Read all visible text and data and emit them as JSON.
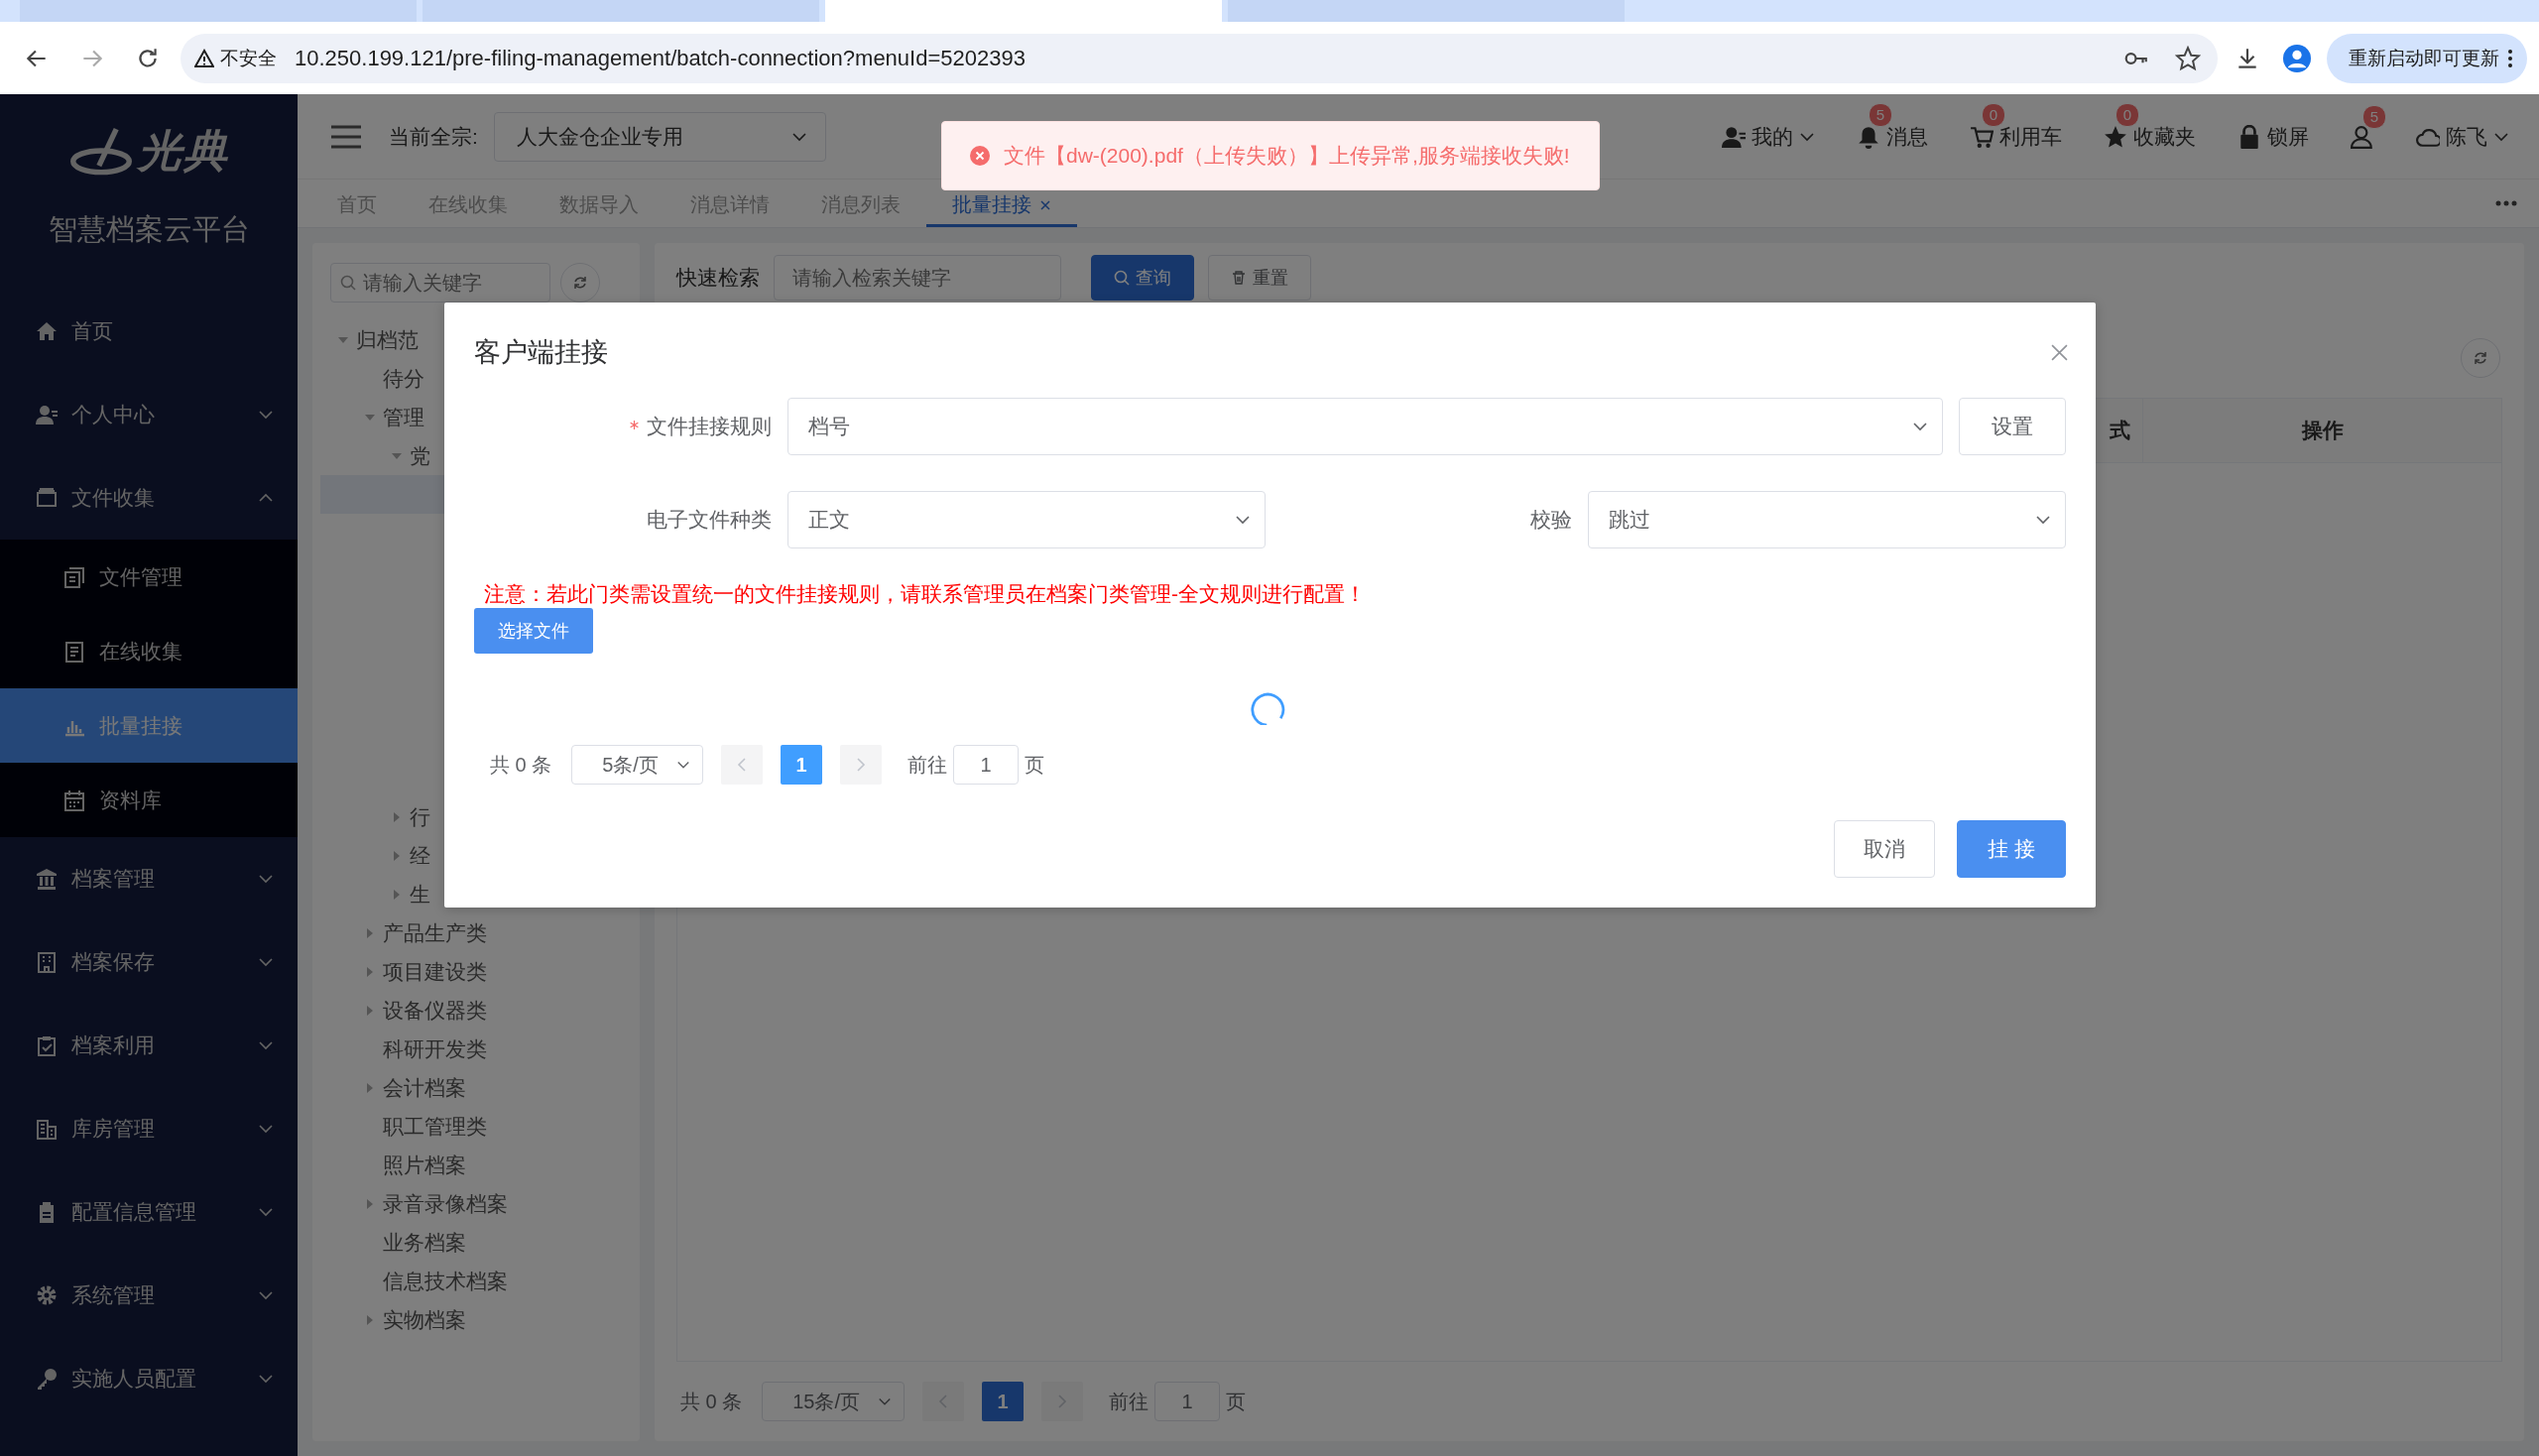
{
  "browser": {
    "tabs": [
      {
        "selected": false
      },
      {
        "selected": false
      },
      {
        "selected": true
      },
      {
        "selected": false
      }
    ],
    "security_label": "不安全",
    "url": "10.250.199.121/pre-filing-management/batch-connection?menuId=5202393",
    "update_button": "重新启动即可更新"
  },
  "logo": {
    "brand": "光典",
    "title": "智慧档案云平台"
  },
  "sidebar": {
    "items": [
      {
        "kind": "home",
        "label": "首页",
        "selected": false
      },
      {
        "kind": "user",
        "label": "个人中心",
        "selected": false,
        "expanded": false
      },
      {
        "kind": "folder",
        "label": "文件收集",
        "selected": false,
        "expanded": true,
        "children": [
          {
            "kind": "files",
            "label": "文件管理",
            "selected": false
          },
          {
            "kind": "doc",
            "label": "在线收集",
            "selected": false
          },
          {
            "kind": "chart",
            "label": "批量挂接",
            "selected": true
          },
          {
            "kind": "calendar",
            "label": "资料库",
            "selected": false
          }
        ]
      },
      {
        "kind": "bank",
        "label": "档案管理",
        "selected": false,
        "expanded": false
      },
      {
        "kind": "building",
        "label": "档案保存",
        "selected": false,
        "expanded": false
      },
      {
        "kind": "check",
        "label": "档案利用",
        "selected": false,
        "expanded": false
      },
      {
        "kind": "store",
        "label": "库房管理",
        "selected": false,
        "expanded": false
      },
      {
        "kind": "clipboard",
        "label": "配置信息管理",
        "selected": false,
        "expanded": false
      },
      {
        "kind": "gear",
        "label": "系统管理",
        "selected": false,
        "expanded": false
      },
      {
        "kind": "key",
        "label": "实施人员配置",
        "selected": false,
        "expanded": false
      }
    ]
  },
  "header": {
    "fonds_label": "当前全宗:",
    "fonds_value": "人大金仓企业专用",
    "items": [
      {
        "kind": "user",
        "label": "我的",
        "dropdown": true
      },
      {
        "kind": "bell",
        "label": "消息",
        "badge": "5",
        "dropdown": false
      },
      {
        "kind": "cart",
        "label": "利用车",
        "badge": "0",
        "dropdown": false
      },
      {
        "kind": "star",
        "label": "收藏夹",
        "badge": "0",
        "dropdown": false
      },
      {
        "kind": "lock",
        "label": "锁屏",
        "dropdown": false
      },
      {
        "kind": "people",
        "badge": "5",
        "dropdown": false
      },
      {
        "kind": "cloud",
        "label": "陈飞",
        "dropdown": true
      }
    ]
  },
  "page_tabs": [
    {
      "label": "首页",
      "selected": false,
      "closable": false
    },
    {
      "label": "在线收集",
      "selected": false,
      "closable": false
    },
    {
      "label": "数据导入",
      "selected": false,
      "closable": false
    },
    {
      "label": "消息详情",
      "selected": false,
      "closable": false
    },
    {
      "label": "消息列表",
      "selected": false,
      "closable": false
    },
    {
      "label": "批量挂接",
      "selected": true,
      "closable": true
    }
  ],
  "tree": {
    "search_placeholder": "请输入关键字",
    "nodes": [
      {
        "label": "归档范",
        "selected": false,
        "expanded": true,
        "children": [
          {
            "label": "待分",
            "selected": false
          },
          {
            "label": "管理",
            "selected": false,
            "expanded": true,
            "children": [
              {
                "label": "党",
                "selected": false,
                "expanded": true,
                "children": [
                  {
                    "selected": true
                  }
                ]
              },
              {
                "label": "行",
                "selected": false,
                "expanded": false
              },
              {
                "label": "经",
                "selected": false,
                "expanded": false
              },
              {
                "label": "生",
                "selected": false,
                "expanded": false
              }
            ]
          },
          {
            "label": "产品生产类",
            "selected": false,
            "expanded": false
          },
          {
            "label": "项目建设类",
            "selected": false,
            "expanded": false
          },
          {
            "label": "设备仪器类",
            "selected": false,
            "expanded": false
          },
          {
            "label": "科研开发类",
            "selected": false
          },
          {
            "label": "会计档案",
            "selected": false,
            "expanded": false
          },
          {
            "label": "职工管理类",
            "selected": false
          },
          {
            "label": "照片档案",
            "selected": false
          },
          {
            "label": "录音录像档案",
            "selected": false,
            "expanded": false
          },
          {
            "label": "业务档案",
            "selected": false
          },
          {
            "label": "信息技术档案",
            "selected": false
          },
          {
            "label": "实物档案",
            "selected": false,
            "expanded": false
          }
        ]
      }
    ]
  },
  "main": {
    "quick_search": {
      "label": "快速检索",
      "placeholder": "请输入检索关键字",
      "search_button": "查询",
      "reset_button": "重置"
    },
    "table": {
      "columns": [
        {
          "label": "式"
        },
        {
          "label": "操作"
        }
      ]
    },
    "pagination": {
      "total": "共 0 条",
      "page_size": "15条/页",
      "pages": [
        {
          "label": "1",
          "selected": true
        }
      ],
      "goto_label": "前往",
      "goto_value": "1",
      "page_suffix": "页"
    }
  },
  "dialog": {
    "title": "客户端挂接",
    "rule_field": {
      "label": "文件挂接规则",
      "required": true,
      "value": "档号"
    },
    "settings_button": "设置",
    "type_field": {
      "label": "电子文件种类",
      "required": false,
      "value": "正文"
    },
    "check_field": {
      "label": "校验",
      "required": false,
      "value": "跳过"
    },
    "notice": "注意：若此门类需设置统一的文件挂接规则，请联系管理员在档案门类管理-全文规则进行配置！",
    "select_button": "选择文件",
    "loading": true,
    "pagination": {
      "total": "共 0 条",
      "page_size": "5条/页",
      "pages": [
        {
          "label": "1",
          "selected": true
        }
      ],
      "goto_label": "前往",
      "goto_value": "1",
      "page_suffix": "页"
    },
    "buttons": [
      {
        "label": "取消",
        "kind": "default"
      },
      {
        "label": "挂 接",
        "kind": "primary"
      }
    ]
  },
  "toast": {
    "kind": "error",
    "text": "文件【dw-(200).pdf（上传失败）】上传异常,服务端接收失败!"
  }
}
